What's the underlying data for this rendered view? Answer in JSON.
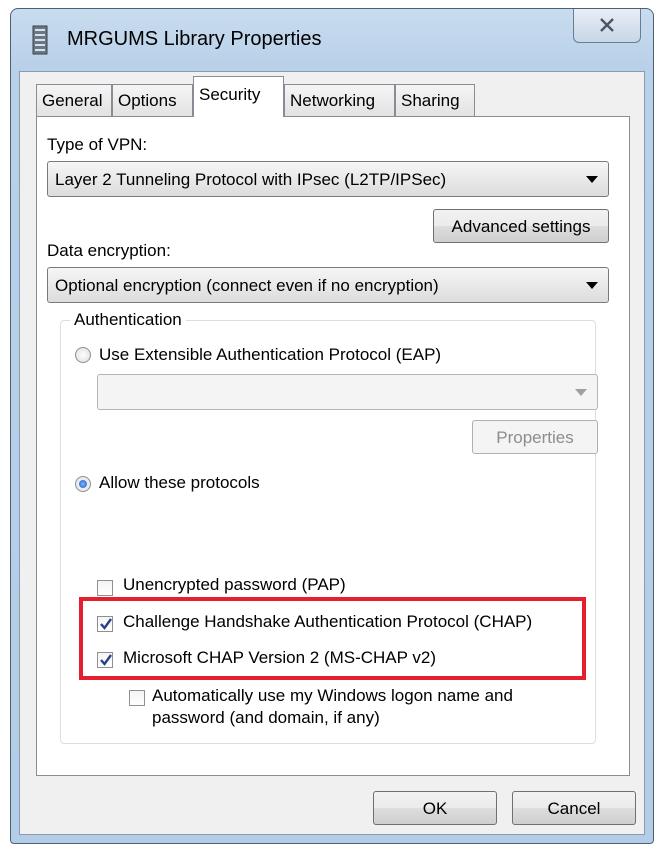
{
  "window": {
    "title": "MRGUMS Library Properties",
    "icon": "library-document-icon"
  },
  "tabs": [
    {
      "label": "General",
      "active": false
    },
    {
      "label": "Options",
      "active": false
    },
    {
      "label": "Security",
      "active": true
    },
    {
      "label": "Networking",
      "active": false
    },
    {
      "label": "Sharing",
      "active": false
    }
  ],
  "security": {
    "vpn_type_label": "Type of VPN:",
    "vpn_type_value": "Layer 2 Tunneling Protocol with IPsec (L2TP/IPSec)",
    "advanced_label": "Advanced settings",
    "encryption_label": "Data encryption:",
    "encryption_value": "Optional encryption (connect even if no encryption)",
    "auth": {
      "title": "Authentication",
      "eap_label": "Use Extensible Authentication Protocol (EAP)",
      "eap_selected": false,
      "eap_combo_value": "",
      "properties_label": "Properties",
      "allow_label": "Allow these protocols",
      "allow_selected": true,
      "protocols": {
        "pap": {
          "label": "Unencrypted password (PAP)",
          "checked": false
        },
        "chap": {
          "label": "Challenge Handshake Authentication Protocol (CHAP)",
          "checked": true
        },
        "mschap": {
          "label": "Microsoft CHAP Version 2 (MS-CHAP v2)",
          "checked": true
        },
        "autologon_line1": "Automatically use my Windows logon name and",
        "autologon_line2": "password (and domain, if any)",
        "autologon_checked": false
      }
    }
  },
  "footer": {
    "ok_label": "OK",
    "cancel_label": "Cancel"
  },
  "colors": {
    "highlight": "#e5202e",
    "accent": "#1a5dbf"
  }
}
